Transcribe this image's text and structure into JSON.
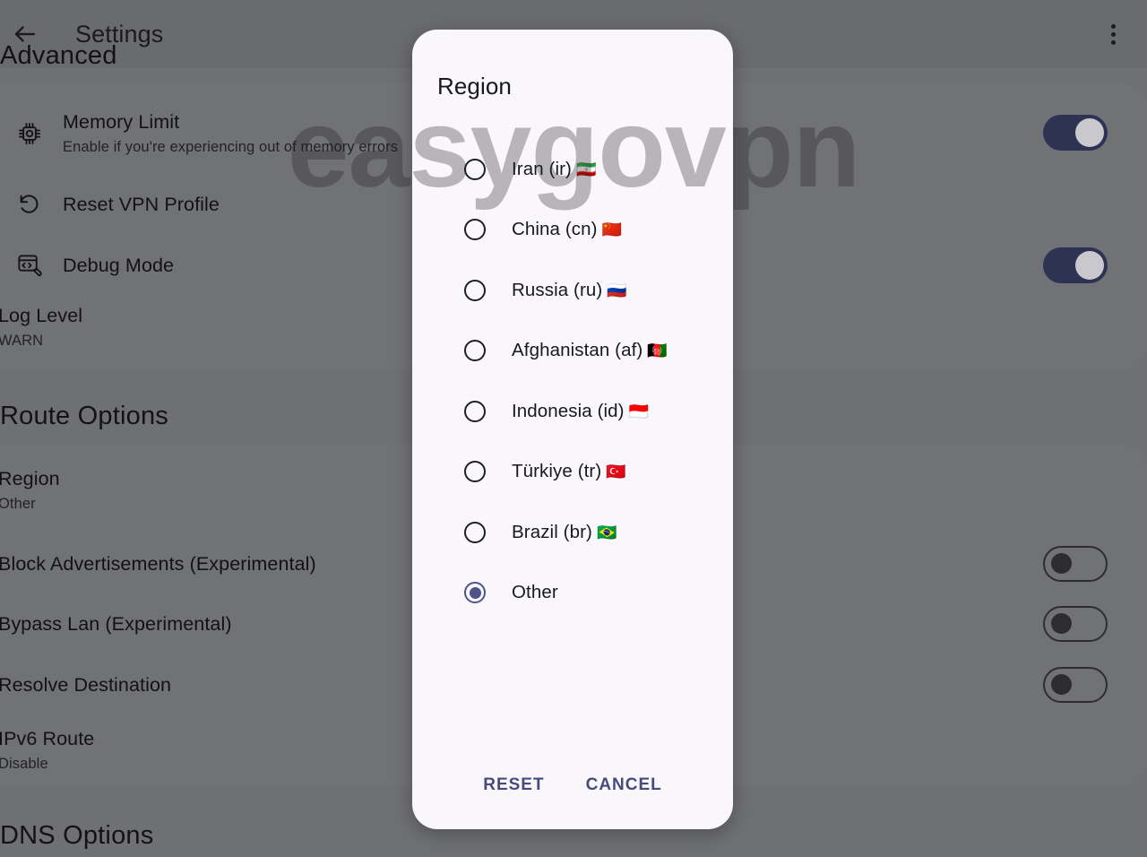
{
  "appbar": {
    "back_icon": "arrow-left-icon",
    "title": "Settings",
    "overflow_icon": "more-vertical-icon"
  },
  "watermark": {
    "text": "easygovpn"
  },
  "sections": {
    "advanced": {
      "header": "Advanced"
    },
    "route": {
      "header": "Route Options"
    },
    "dns": {
      "header": "DNS Options"
    }
  },
  "advanced_rows": [
    {
      "icon": "memory-chip-icon",
      "title": "Memory Limit",
      "subtitle": "Enable if you're experiencing out of memory errors",
      "toggle": "on"
    },
    {
      "icon": "reset-arrow-icon",
      "title": "Reset VPN Profile",
      "subtitle": "",
      "toggle": "none"
    },
    {
      "icon": "debug-code-wrench-icon",
      "title": "Debug Mode",
      "subtitle": "",
      "toggle": "on"
    },
    {
      "icon": "",
      "title": "Log Level",
      "subtitle": "WARN",
      "toggle": "none"
    }
  ],
  "route_rows": [
    {
      "title": "Region",
      "subtitle": "Other",
      "toggle": "none"
    },
    {
      "title": "Block Advertisements (Experimental)",
      "subtitle": "",
      "toggle": "off"
    },
    {
      "title": "Bypass Lan (Experimental)",
      "subtitle": "",
      "toggle": "off"
    },
    {
      "title": "Resolve Destination",
      "subtitle": "",
      "toggle": "off"
    },
    {
      "title": "IPv6 Route",
      "subtitle": "Disable",
      "toggle": "none"
    }
  ],
  "dialog": {
    "title": "Region",
    "options": [
      {
        "label": "Iran (ir)",
        "flag": "🇮🇷",
        "selected": false
      },
      {
        "label": "China (cn)",
        "flag": "🇨🇳",
        "selected": false
      },
      {
        "label": "Russia (ru)",
        "flag": "🇷🇺",
        "selected": false
      },
      {
        "label": "Afghanistan (af)",
        "flag": "🇦🇫",
        "selected": false
      },
      {
        "label": "Indonesia (id)",
        "flag": "🇮🇩",
        "selected": false
      },
      {
        "label": "Türkiye (tr)",
        "flag": "🇹🇷",
        "selected": false
      },
      {
        "label": "Brazil (br)",
        "flag": "🇧🇷",
        "selected": false
      },
      {
        "label": "Other",
        "flag": "",
        "selected": true
      }
    ],
    "reset_label": "RESET",
    "cancel_label": "CANCEL"
  },
  "colors": {
    "scrim": "#6f7073",
    "card": "#717276",
    "dialog_bg": "#f9f7fb",
    "toggle_on": "#2e3353",
    "radio_selected": "#4e5488",
    "action_text": "#464b7c"
  }
}
